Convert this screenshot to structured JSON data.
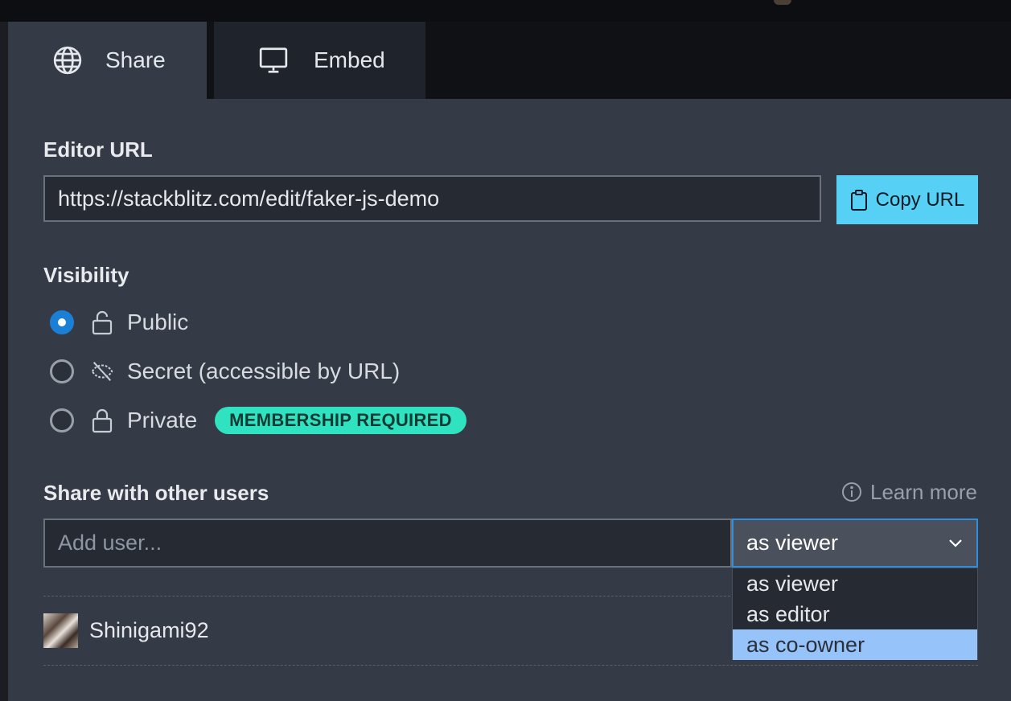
{
  "tabs": [
    {
      "label": "Share",
      "icon": "globe-icon",
      "active": true
    },
    {
      "label": "Embed",
      "icon": "monitor-icon",
      "active": false
    }
  ],
  "editor_url": {
    "label": "Editor URL",
    "value": "https://stackblitz.com/edit/faker-js-demo",
    "copy_button": "Copy URL"
  },
  "visibility": {
    "label": "Visibility",
    "options": [
      {
        "label": "Public",
        "icon": "unlock-icon",
        "selected": true
      },
      {
        "label": "Secret (accessible by URL)",
        "icon": "eye-off-icon",
        "selected": false
      },
      {
        "label": "Private",
        "icon": "lock-icon",
        "selected": false,
        "badge": "MEMBERSHIP REQUIRED"
      }
    ]
  },
  "share_users": {
    "label": "Share with other users",
    "learn_more": "Learn more",
    "add_user_placeholder": "Add user...",
    "role_selected": "as viewer",
    "role_options": [
      "as viewer",
      "as editor",
      "as co-owner"
    ],
    "highlighted_option": "as co-owner",
    "users": [
      {
        "name": "Shinigami92"
      }
    ]
  },
  "colors": {
    "accent_button": "#56d0f5",
    "badge": "#30e3c0",
    "radio_checked": "#1b7fd6",
    "dropdown_highlight": "#95c3fa"
  }
}
